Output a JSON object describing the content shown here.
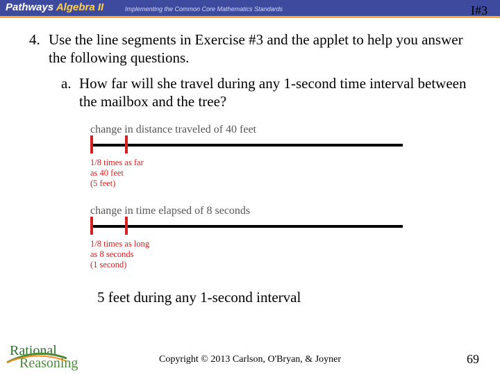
{
  "header": {
    "brand_prefix": "Pathways ",
    "brand_suffix": "Algebra II",
    "subtitle": "Implementing the Common Core Mathematics Standards",
    "page_ref": "I#3"
  },
  "question4": {
    "number": "4.",
    "text": "Use the line segments in Exercise #3 and the applet to help you answer the following questions."
  },
  "question4a": {
    "number": "a.",
    "text": "How far will she travel during any 1-second time interval between the mailbox and the tree?"
  },
  "diagram": {
    "dist_label": "change in distance traveled of 40 feet",
    "dist_small_l1": "1/8 times as far",
    "dist_small_l2": "as 40 feet",
    "dist_small_l3": "(5 feet)",
    "time_label": "change in time elapsed of 8 seconds",
    "time_small_l1": "1/8 times as long",
    "time_small_l2": "as 8 seconds",
    "time_small_l3": "(1 second)"
  },
  "answer": "5 feet during any 1-second interval",
  "footer": {
    "copyright": "Copyright © 2013 Carlson, O'Bryan, & Joyner",
    "page": "69",
    "logo_top": "Rational",
    "logo_bottom": "Reasoning"
  }
}
